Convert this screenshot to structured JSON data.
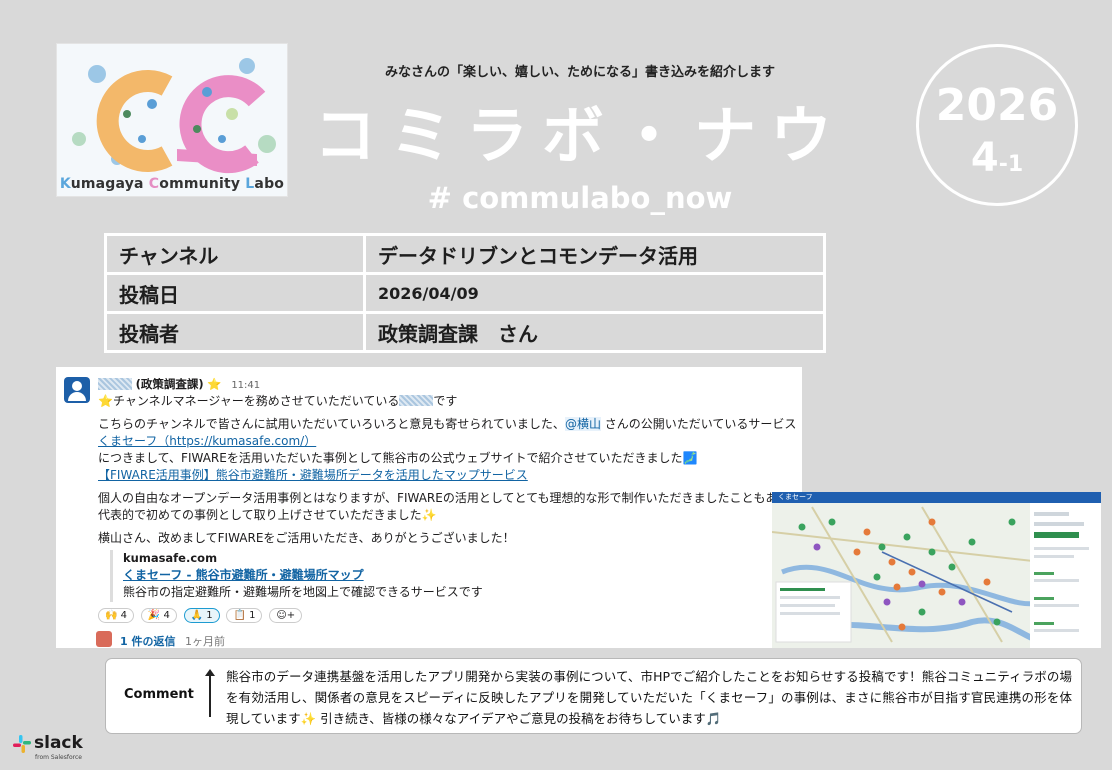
{
  "logo": {
    "k": "K",
    "rest1": "umagaya ",
    "c": "C",
    "rest2": "ommunity ",
    "l": "L",
    "rest3": "abo"
  },
  "header": {
    "subtitle": "みなさんの「楽しい、嬉しい、ためになる」書き込みを紹介します",
    "title": "コミラボ・ナウ",
    "hashtag": "# commulabo_now"
  },
  "issue": {
    "year": "2026",
    "number": "4",
    "suffix": "-1"
  },
  "info": {
    "channel_label": "チャンネル",
    "channel_value": "データドリブンとコモンデータ活用",
    "date_label": "投稿日",
    "date_value": "2026/04/09",
    "author_label": "投稿者",
    "author_value": "政策調査課　さん"
  },
  "post": {
    "author_suffix": "(政策調査課)",
    "star": "⭐",
    "time": "11:41",
    "line1_pre": "⭐チャンネルマネージャーを務めさせていただいている",
    "line1_post": "です",
    "line2_pre": "こちらのチャンネルで皆さんに試用いただいていろいろと意見も寄せられていました、",
    "mention": "@横山",
    "line2_post": " さんの公開いただいているサービス",
    "line3_link": "くまセーフ（https://kumasafe.com/）",
    "line4": "につきまして、FIWAREを活用いただいた事例として熊谷市の公式ウェブサイトで紹介させていただきました🗾",
    "line5_link": "【FIWARE活用事例】熊谷市避難所・避難場所データを活用したマップサービス",
    "line6": "個人の自由なオープンデータ活用事例とはなりますが、FIWAREの活用としてとても理想的な形で制作いただきましたこともあり",
    "line7": "代表的で初めての事例として取り上げさせていただきました✨",
    "line8": "横山さん、改めましてFIWAREをご活用いただき、ありがとうございました！",
    "unfurl_site": "kumasafe.com",
    "unfurl_title": "くまセーフ - 熊谷市避難所・避難場所マップ",
    "unfurl_desc": "熊谷市の指定避難所・避難場所を地図上で確認できるサービスです",
    "reactions": [
      "🙌 4",
      "🎉 4",
      "🙏 1",
      "📋 1",
      "☺+"
    ],
    "reply_count": "1 件の返信",
    "reply_ago": "1ヶ月前"
  },
  "map": {
    "header": "くまセーフ"
  },
  "comment": {
    "label": "Comment",
    "text": "熊谷市のデータ連携基盤を活用したアプリ開発から実装の事例について、市HPでご紹介したことをお知らせする投稿です！熊谷コミュニティラボの場を有効活用し、関係者の意見をスピーディに反映したアプリを開発していただいた「くまセーフ」の事例は、まさに熊谷市が目指す官民連携の形を体現しています✨ 引き続き、皆様の様々なアイデアやご意見の投稿をお待ちしています🎵"
  },
  "footer": {
    "brand": "slack",
    "from": "from Salesforce"
  }
}
